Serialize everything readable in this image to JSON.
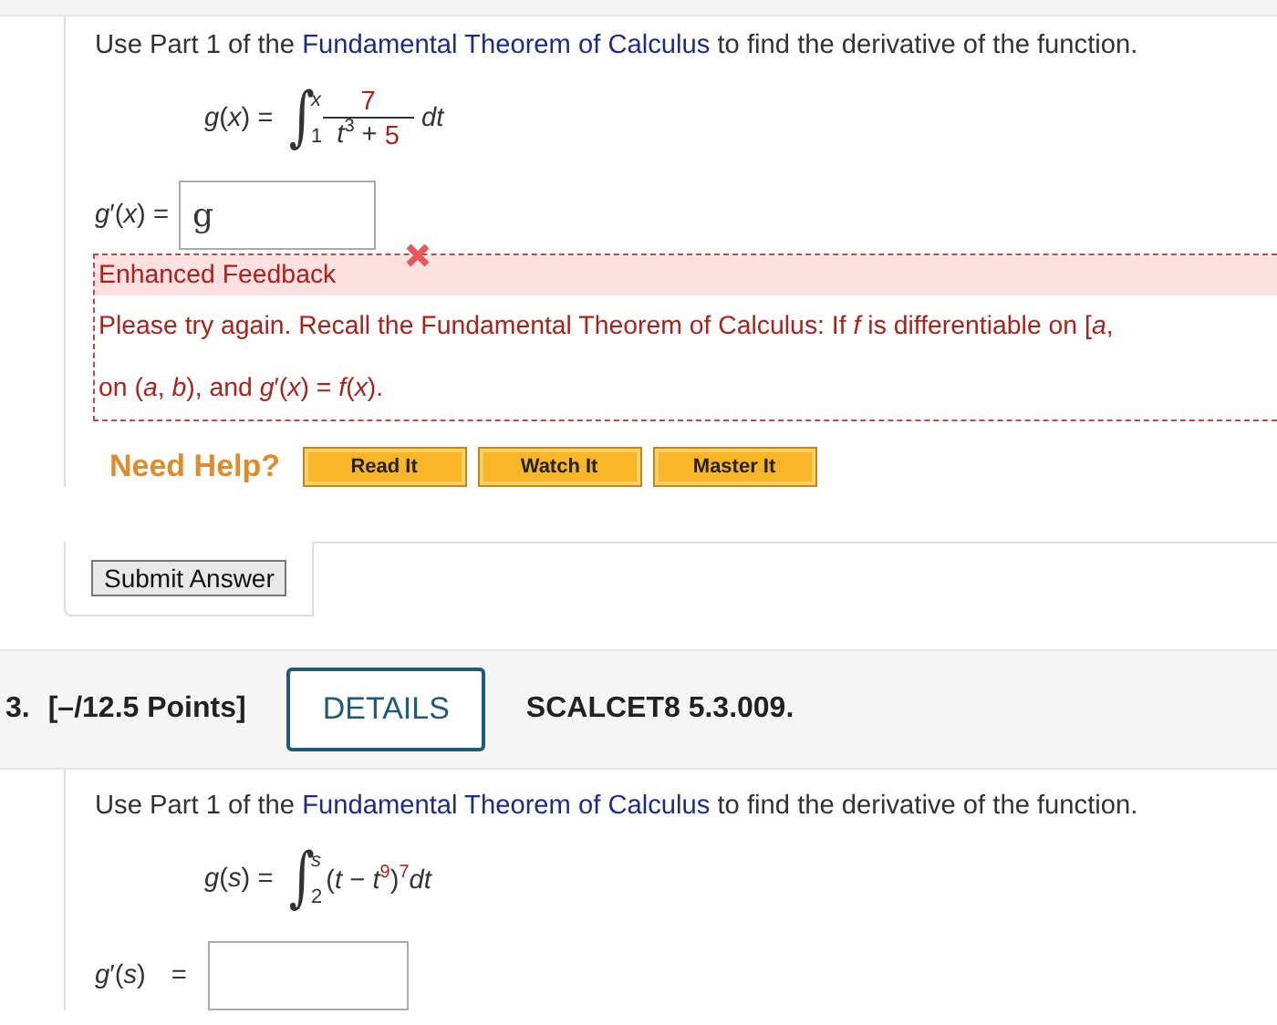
{
  "question_2": {
    "instruction": {
      "before": "Use Part 1 of the",
      "link": "Fundamental Theorem of Calculus",
      "after": "to find the derivative of the function."
    },
    "formula": {
      "lhs": "*g*(*x*) =",
      "sign": "∫",
      "upper": "*x*",
      "lower": "1",
      "numerator": [
        {
          "text": "7",
          "highlight": true
        }
      ],
      "denominator": [
        {
          "text": "*t*$^{3}$ + ",
          "highlight": false
        },
        {
          "text": "5",
          "highlight": true
        }
      ],
      "tail": [
        {
          "text": "*dt*",
          "highlight": false
        }
      ]
    },
    "answer": {
      "label": "*g*′(*x*) =",
      "value": "g",
      "correct": false
    },
    "feedback": {
      "title": "Enhanced Feedback",
      "lines": [
        "Please try again. Recall the Fundamental Theorem of Calculus: If *f* is differentiable on  [*a*,",
        "on  (*a*, *b*),  and  *g*′(*x*) = *f*(*x*)."
      ]
    },
    "help": {
      "label": "Need Help?",
      "buttons": [
        "Read It",
        "Watch It",
        "Master It"
      ]
    },
    "submit": "Submit Answer"
  },
  "question_3": {
    "number": "3.",
    "points": "[–/12.5 Points]",
    "details": "DETAILS",
    "code": "SCALCET8 5.3.009.",
    "instruction": {
      "before": "Use Part 1 of the",
      "link": "Fundamental Theorem of Calculus",
      "after": "to find the derivative of the function."
    },
    "formula": {
      "lhs": "*g*(*s*) =",
      "sign": "∫",
      "upper": "*s*",
      "lower": "2",
      "tail": [
        {
          "text": "(*t* − *t*",
          "highlight": false
        },
        {
          "text": "$^{9}$",
          "highlight": true
        },
        {
          "text": ")",
          "highlight": false
        },
        {
          "text": "$^{7}$",
          "highlight": true
        },
        {
          "text": "*dt*",
          "highlight": false
        }
      ]
    },
    "answer": {
      "label": "*g*′(*s*)",
      "equals": "="
    }
  }
}
